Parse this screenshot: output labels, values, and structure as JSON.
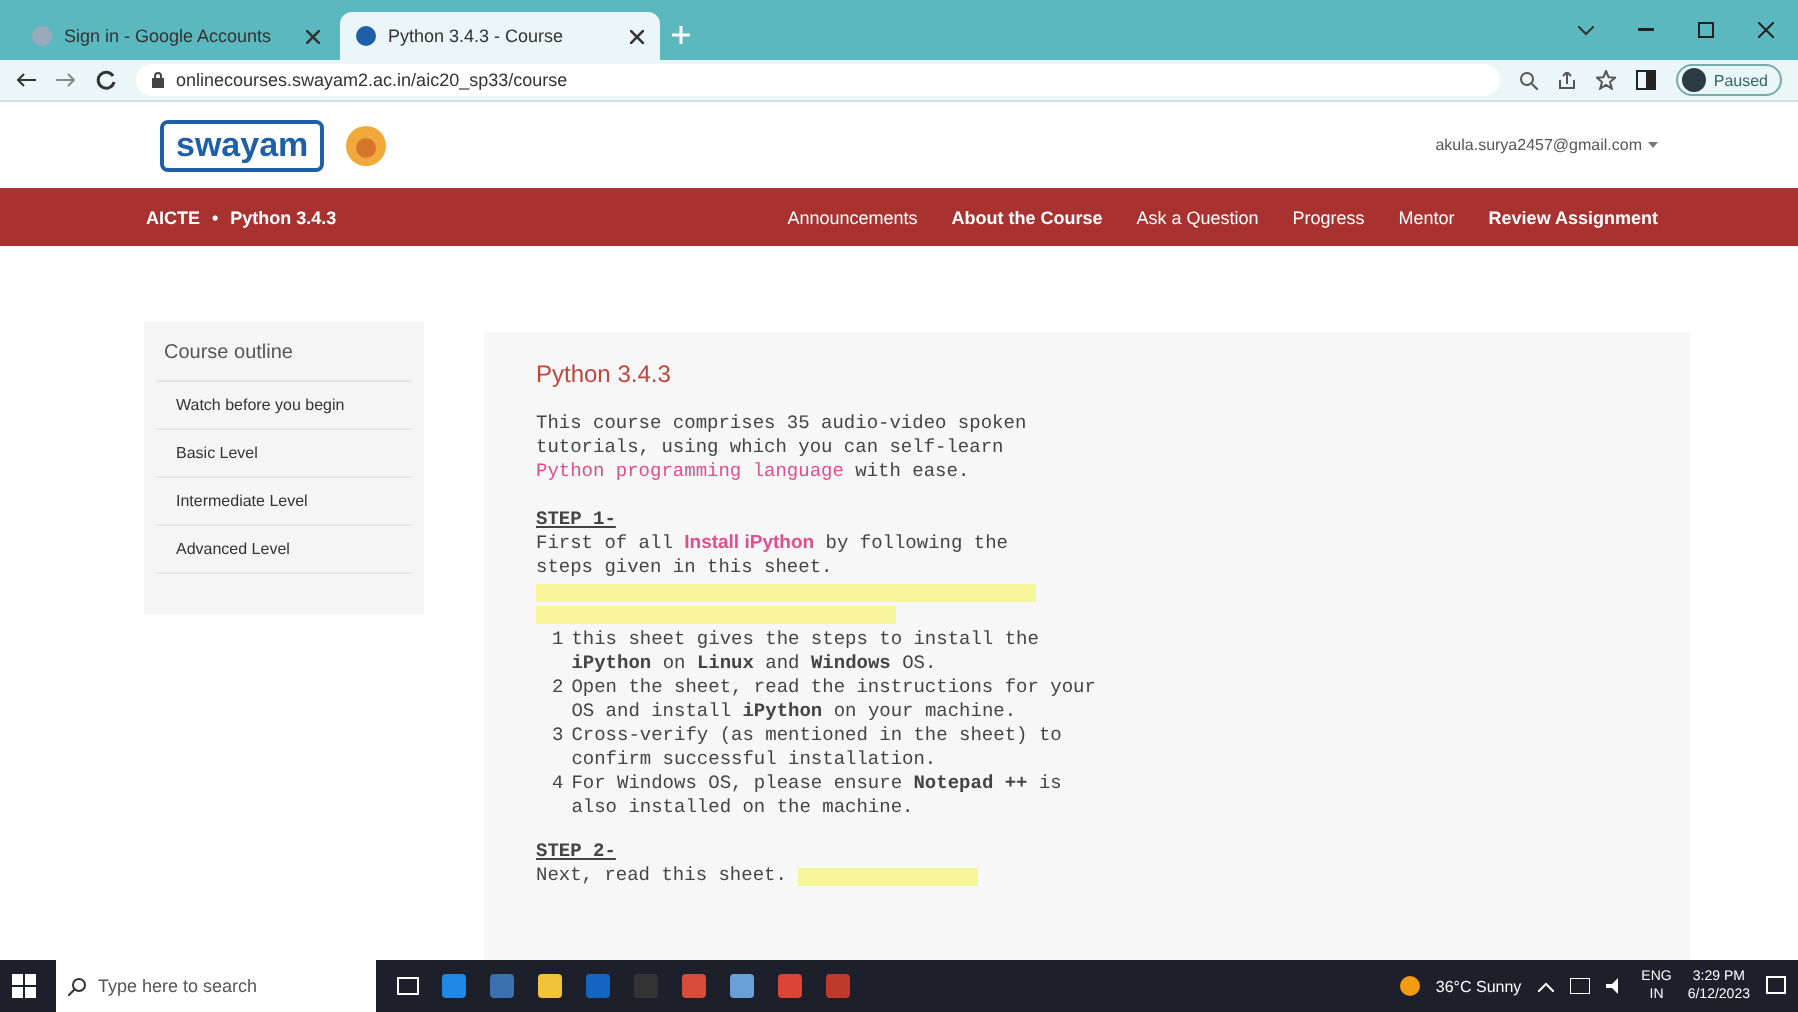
{
  "browser": {
    "tabs": [
      {
        "label": "Sign in - Google Accounts",
        "selected": false
      },
      {
        "label": "Python 3.4.3 - Course",
        "selected": true
      }
    ],
    "address": "onlinecourses.swayam2.ac.in/aic20_sp33/course",
    "profile_status": "Paused"
  },
  "header": {
    "logo_text": "swayam",
    "account": "akula.surya2457@gmail.com"
  },
  "nav": {
    "breadcrumb": [
      "AICTE",
      "•",
      "Python 3.4.3"
    ],
    "items": [
      {
        "label": "Announcements",
        "emphasis": false
      },
      {
        "label": "About the Course",
        "emphasis": true
      },
      {
        "label": "Ask a Question",
        "emphasis": false
      },
      {
        "label": "Progress",
        "emphasis": false
      },
      {
        "label": "Mentor",
        "emphasis": false
      },
      {
        "label": "Review Assignment",
        "emphasis": true
      }
    ]
  },
  "sidebar": {
    "title": "Course outline",
    "items": [
      "Watch before you begin",
      "Basic Level",
      "Intermediate Level",
      "Advanced Level"
    ]
  },
  "content": {
    "title": "Python 3.4.3",
    "intro": {
      "before": "This course comprises 35 audio-video spoken tutorials, using which you can self-learn",
      "link": "Python programming language",
      "after": "with ease."
    },
    "step1": {
      "heading": "STEP 1-",
      "before": "First of all",
      "link": "Install iPython",
      "after": "by following the steps given in this sheet."
    },
    "steps": [
      {
        "marker": "1",
        "text": "this sheet gives the steps to install the **iPython** on **Linux** and **Windows** OS."
      },
      {
        "marker": "2",
        "text": "Open the sheet, read the instructions for your OS and install **iPython** on your machine."
      },
      {
        "marker": "3",
        "text": "Cross-verify (as mentioned in the sheet) to confirm successful installation."
      },
      {
        "marker": "4",
        "text": "For Windows OS, please ensure **Notepad ++** is also installed on the machine."
      }
    ],
    "step2": {
      "heading": "STEP 2-",
      "text": "Next, read this sheet."
    }
  },
  "taskbar": {
    "search_placeholder": "Type here to search",
    "weather": "36°C Sunny",
    "language": "ENG",
    "region": "IN",
    "time": "3:29 PM",
    "date": "6/12/2023"
  }
}
